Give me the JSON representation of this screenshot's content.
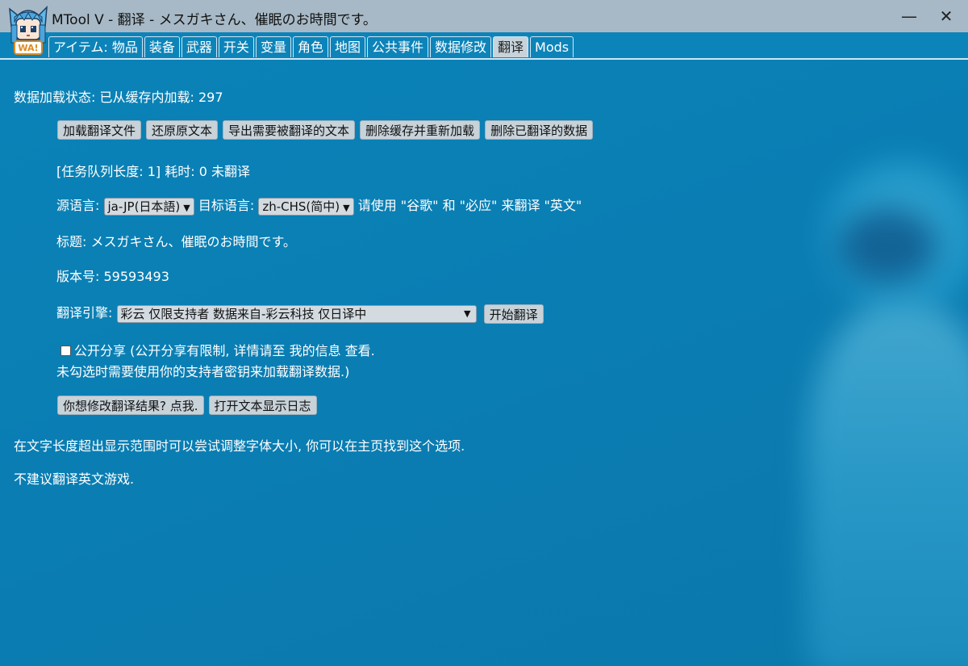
{
  "window": {
    "title": "MTool V - 翻译 - メスガキさん、催眠のお時間です。",
    "minimize_glyph": "—",
    "close_glyph": "✕",
    "icon_label": "WA!"
  },
  "tabs": [
    {
      "label": "アイテム: 物品",
      "active": false
    },
    {
      "label": "装备",
      "active": false
    },
    {
      "label": "武器",
      "active": false
    },
    {
      "label": "开关",
      "active": false
    },
    {
      "label": "变量",
      "active": false
    },
    {
      "label": "角色",
      "active": false
    },
    {
      "label": "地图",
      "active": false
    },
    {
      "label": "公共事件",
      "active": false
    },
    {
      "label": "数据修改",
      "active": false
    },
    {
      "label": "翻译",
      "active": true
    },
    {
      "label": "Mods",
      "active": false
    }
  ],
  "status": {
    "load_status": "数据加载状态: 已从缓存内加载: 297",
    "queue": "[任务队列长度: 1] 耗时: 0 未翻译"
  },
  "actions": {
    "load_translation": "加载翻译文件",
    "restore_text": "还原原文本",
    "export_text": "导出需要被翻译的文本",
    "delete_cache_reload": "删除缓存并重新加载",
    "delete_translated": "删除已翻译的数据"
  },
  "language": {
    "source_label": "源语言:",
    "source_value": "ja-JP(日本語)",
    "target_label": "目标语言:",
    "target_value": "zh-CHS(简中)",
    "hint": "请使用 \"谷歌\" 和 \"必应\" 来翻译 \"英文\""
  },
  "info": {
    "title": "标题: メスガキさん、催眠のお時間です。",
    "version": "版本号: 59593493"
  },
  "engine": {
    "label": "翻译引擎:",
    "value": "彩云 仅限支持者 数据来自-彩云科技 仅日译中",
    "start_button": "开始翻译"
  },
  "share": {
    "checked": false,
    "line1": "公开分享 (公开分享有限制, 详情请至 我的信息 查看.",
    "line2": "未勾选时需要使用你的支持者密钥来加载翻译数据.)"
  },
  "bottom_buttons": {
    "modify_result": "你想修改翻译结果? 点我.",
    "open_log": "打开文本显示日志"
  },
  "notes": {
    "font_tip": "在文字长度超出显示范围时可以尝试调整字体大小, 你可以在主页找到这个选项.",
    "english_tip": "不建议翻译英文游戏."
  }
}
